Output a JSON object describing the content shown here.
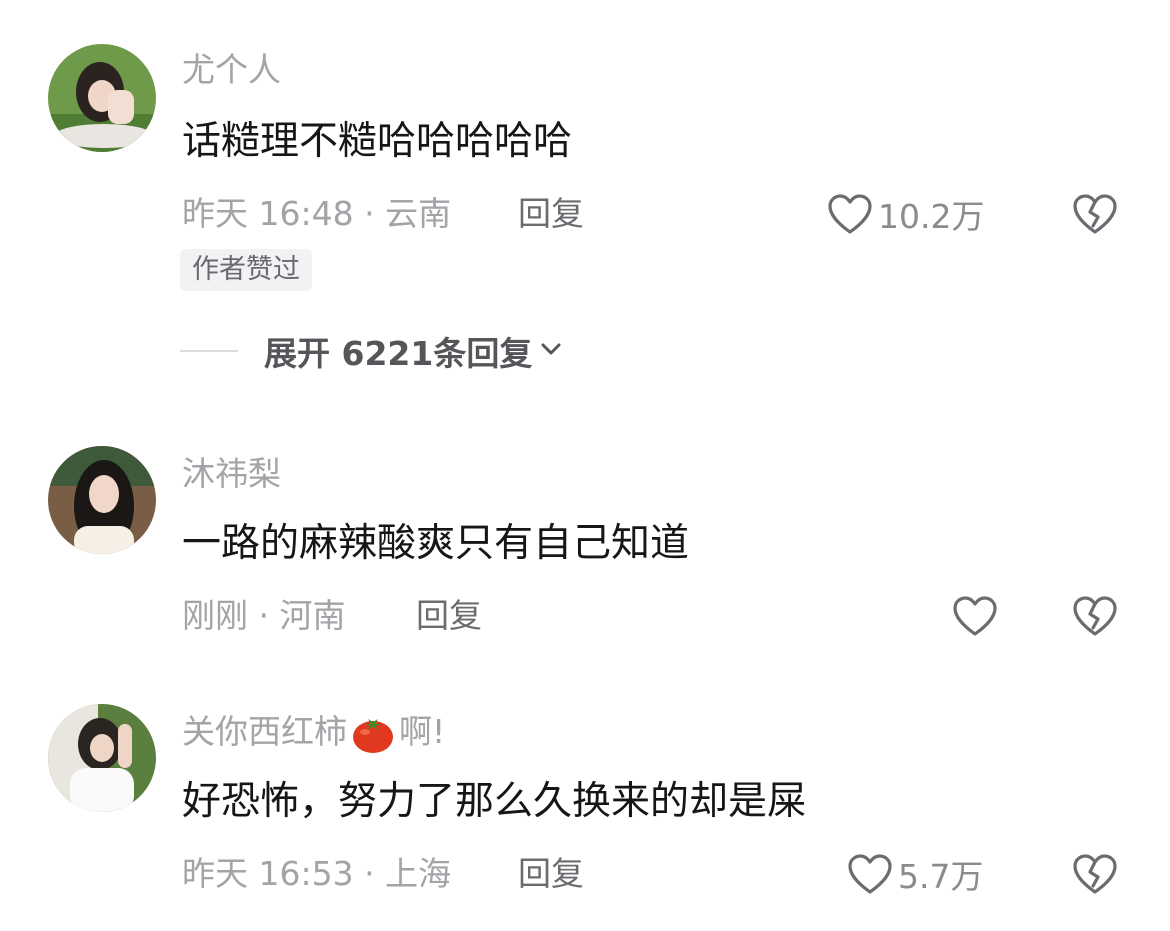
{
  "comments": [
    {
      "username": "尤个人",
      "text": "话糙理不糙哈哈哈哈哈",
      "time": "昨天 16:48",
      "location": "· 云南",
      "reply_label": "回复",
      "likes": "10.2万",
      "badge": "作者赞过",
      "expand_label": "展开 6221条回复"
    },
    {
      "username": "沐祎梨",
      "text": "一路的麻辣酸爽只有自己知道",
      "time": "刚刚",
      "location": "· 河南",
      "reply_label": "回复",
      "likes": ""
    },
    {
      "username_prefix": "关你西红柿",
      "username_suffix": "啊!",
      "username_emoji": "tomato-emoji",
      "text": "好恐怖，努力了那么久换来的却是屎",
      "time": "昨天 16:53",
      "location": "· 上海",
      "reply_label": "回复",
      "likes": "5.7万"
    }
  ],
  "icons": {
    "like": "heart-outline-icon",
    "dislike": "broken-heart-icon",
    "expand": "chevron-down-icon"
  },
  "colors": {
    "username": "#a3a3a8",
    "text": "#161616",
    "reply": "#6c6c70",
    "badge_bg": "#f2f2f4"
  }
}
